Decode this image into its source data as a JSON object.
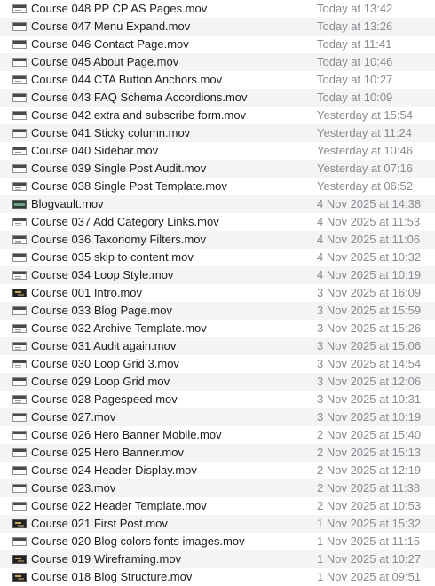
{
  "files": [
    {
      "name": "Course 048 PP CP AS Pages.mov",
      "date": "Today at 13:42",
      "thumb": "doc-lines"
    },
    {
      "name": "Course 047 Menu Expand.mov",
      "date": "Today at 13:26",
      "thumb": "doc"
    },
    {
      "name": "Course 046 Contact Page.mov",
      "date": "Today at 11:41",
      "thumb": "doc"
    },
    {
      "name": "Course 045 About Page.mov",
      "date": "Today at 10:46",
      "thumb": "doc"
    },
    {
      "name": "Course 044 CTA Button Anchors.mov",
      "date": "Today at 10:27",
      "thumb": "doc-lines"
    },
    {
      "name": "Course 043 FAQ Schema Accordions.mov",
      "date": "Today at 10:09",
      "thumb": "doc"
    },
    {
      "name": "Course 042 extra and subscribe form.mov",
      "date": "Yesterday at 15:54",
      "thumb": "doc"
    },
    {
      "name": "Course 041 Sticky column.mov",
      "date": "Yesterday at 11:24",
      "thumb": "doc"
    },
    {
      "name": "Course 040 Sidebar.mov",
      "date": "Yesterday at 10:46",
      "thumb": "doc-lines"
    },
    {
      "name": "Course 039 Single Post Audit.mov",
      "date": "Yesterday at 07:16",
      "thumb": "doc"
    },
    {
      "name": "Course 038 Single Post Template.mov",
      "date": "Yesterday at 06:52",
      "thumb": "doc-lines"
    },
    {
      "name": "Blogvault.mov",
      "date": "4 Nov 2025 at 14:38",
      "thumb": "green"
    },
    {
      "name": "Course 037 Add Category Links.mov",
      "date": "4 Nov 2025 at 11:53",
      "thumb": "doc-lines"
    },
    {
      "name": "Course 036 Taxonomy Filters.mov",
      "date": "4 Nov 2025 at 11:06",
      "thumb": "doc-lines"
    },
    {
      "name": "Course 035 skip to content.mov",
      "date": "4 Nov 2025 at 10:32",
      "thumb": "doc"
    },
    {
      "name": "Course 034 Loop Style.mov",
      "date": "4 Nov 2025 at 10:19",
      "thumb": "doc-lines"
    },
    {
      "name": "Course 001 Intro.mov",
      "date": "3 Nov 2025 at 16:09",
      "thumb": "dark"
    },
    {
      "name": "Course 033 Blog Page.mov",
      "date": "3 Nov 2025 at 15:59",
      "thumb": "doc"
    },
    {
      "name": "Course 032 Archive Template.mov",
      "date": "3 Nov 2025 at 15:26",
      "thumb": "doc-lines"
    },
    {
      "name": "Course 031 Audit again.mov",
      "date": "3 Nov 2025 at 15:06",
      "thumb": "doc-lines"
    },
    {
      "name": "Course 030 Loop Grid 3.mov",
      "date": "3 Nov 2025 at 14:54",
      "thumb": "doc-lines"
    },
    {
      "name": "Course 029 Loop Grid.mov",
      "date": "3 Nov 2025 at 12:06",
      "thumb": "doc"
    },
    {
      "name": "Course 028 Pagespeed.mov",
      "date": "3 Nov 2025 at 10:31",
      "thumb": "doc-lines"
    },
    {
      "name": "Course 027.mov",
      "date": "3 Nov 2025 at 10:19",
      "thumb": "doc"
    },
    {
      "name": "Course 026 Hero Banner Mobile.mov",
      "date": "2 Nov 2025 at 15:40",
      "thumb": "doc"
    },
    {
      "name": "Course 025 Hero Banner.mov",
      "date": "2 Nov 2025 at 15:13",
      "thumb": "doc"
    },
    {
      "name": "Course 024 Header Display.mov",
      "date": "2 Nov 2025 at 12:19",
      "thumb": "doc"
    },
    {
      "name": "Course 023.mov",
      "date": "2 Nov 2025 at 11:38",
      "thumb": "doc"
    },
    {
      "name": "Course 022 Header Template.mov",
      "date": "2 Nov 2025 at 10:53",
      "thumb": "doc"
    },
    {
      "name": "Course 021 First Post.mov",
      "date": "1 Nov 2025 at 15:32",
      "thumb": "dark"
    },
    {
      "name": "Course 020 Blog colors fonts images.mov",
      "date": "1 Nov 2025 at 11:15",
      "thumb": "doc"
    },
    {
      "name": "Course 019 Wireframing.mov",
      "date": "1 Nov 2025 at 10:27",
      "thumb": "dark"
    },
    {
      "name": "Course 018 Blog Structure.mov",
      "date": "1 Nov 2025 at 09:51",
      "thumb": "dark"
    }
  ]
}
